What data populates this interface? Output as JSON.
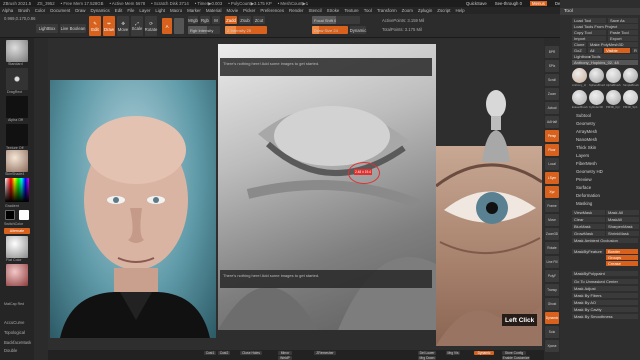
{
  "title_bar": {
    "app": "ZBrush 2021.5",
    "file": "ZS_3952",
    "mem1": "• Free Mem 17.528GB",
    "mem2": "• Active Mem 5678",
    "mem3": "• Scratch Disk 3714",
    "mem4": "• Timer▶0.003",
    "poly": "• PolyCount▶3.175 KP",
    "mesh": "• MeshCount▶1",
    "quicksave": "QuickSave",
    "seethrough": "See-through 0",
    "menus": "Menus",
    "script": "DefaultZScript"
  },
  "menu_bar": [
    "Alpha",
    "Brush",
    "Color",
    "Document",
    "Draw",
    "Dynamics",
    "Edit",
    "File",
    "Layer",
    "Light",
    "Macro",
    "Marker",
    "Material",
    "Movie",
    "Picker",
    "Preferences",
    "Render",
    "Stencil",
    "Stroke",
    "Texture",
    "Tool",
    "Transform",
    "Zoom",
    "Zplugin",
    "Zscript",
    "Help"
  ],
  "coords": "0.969,0.170,0.86",
  "toolbar": {
    "lightbox": "LightBox",
    "live_boolean": "Live Boolean",
    "edit": "Edit",
    "draw": "Draw",
    "move": "Move",
    "scale": "Scale",
    "rotate": "Rotate",
    "a": "A",
    "mrgb": "Mrgb",
    "rgb": "Rgb",
    "m": "M",
    "rgb_intensity": "Rgb Intensity",
    "zadd": "Zadd",
    "zsub": "Zsub",
    "zcut": "Zcut",
    "z_intensity": "Z Intensity 25",
    "focal_shift": "Focal Shift 0",
    "draw_size": "Draw Size 24",
    "dynamic": "Dynamic",
    "active_points": "ActivePoints: 3.159 Mil",
    "total_points": "TotalPoints: 3.175 Mil"
  },
  "left_tray": {
    "brush_label": "Standard",
    "stroke_label": "DragRect",
    "alpha_label": "Alpha Off",
    "texture_label": "Texture Off",
    "material_label": "SkinShade4",
    "gradient": "Gradient",
    "switch_color": "SwitchColor",
    "alternate": "Alternate",
    "flat_color": "Flat Color",
    "mat_label": "MatCap Red",
    "accucurve": "AccuCurve",
    "topological": "Topological",
    "backface_mask": "BackfaceMask",
    "double": "Double"
  },
  "viewport": {
    "spotlight_msg_top": "There's nothing here! Add some images to get started.",
    "spotlight_msg_bottom": "There's nothing here! Add some images to get started.",
    "left_click": "Left Click",
    "brush_readout": "2.48 ± 19.4"
  },
  "bottom_bar": {
    "cust1": "Cust1",
    "cust2": "Cust2",
    "close_holes": "Close Holes",
    "mirror": "Mirror",
    "weld": "WeldP",
    "zremesher": "ZRemesher",
    "del_lower": "Del Lower",
    "mrg_down": "Mrg Down",
    "mrg_vis": "Mrg Vis",
    "dyn": "Dynamic",
    "store_config": "Store Config",
    "enable_customize": "Enable Customize"
  },
  "right_panel": {
    "tool": "Tool",
    "load_tool": "Load Tool",
    "save_as": "Save As",
    "load_tools_from_project": "Load Tools From Project",
    "copy_tool": "Copy Tool",
    "paste_tool": "Paste Tool",
    "import": "Import",
    "export": "Export",
    "clone": "Clone",
    "make_polymesh": "Make PolyMesh3D",
    "goz": "GoZ",
    "all": "All",
    "visible": "Visible",
    "r": "R",
    "lightbox_tools": "Lightbox▸Tools",
    "current_tool": "Anthony_Hopkins_02. 48",
    "thumb_labels": [
      "Anthony_H",
      "SphereBrush",
      "AlphaBrush",
      "SimpleBrush",
      "EraserBrush",
      "Cylinder3D",
      "PM3D_Cyl",
      "PM3D_Sph"
    ],
    "subtool_list": [
      "Subtool",
      "Geometry",
      "ArrayMesh",
      "NanoMesh",
      "Thick Skin",
      "Layers",
      "FiberMesh",
      "Geometry HD",
      "Preview",
      "Surface",
      "Deformation",
      "Masking"
    ],
    "masking_rows": [
      [
        "ViewMask",
        "Mask All"
      ],
      [
        "Clear",
        "MaskAll"
      ],
      [
        "BlurMask",
        "SharpenMask"
      ],
      [
        "GrowMask",
        "ShrinkMask"
      ],
      [
        "Mask Ambient Occlusion",
        ""
      ]
    ],
    "mask_extra": [
      "MaskByFeature",
      "Border",
      "Groups",
      "Crease"
    ],
    "mask_by_polypaint": "MaskByPolypaint",
    "mask_rows2": [
      "Go To Unmasked Center",
      "Mask Adjust",
      "Mask By Fibers",
      "Mask By AO",
      "Mask By Cavity",
      "Mask By Smoothness"
    ]
  },
  "right_shelf": [
    "BPR",
    "SPix",
    "Scroll",
    "Zoom",
    "Actual",
    "AAHalf",
    "Persp",
    "Floor",
    "Local",
    "LSym",
    "Xyz",
    "Frame",
    "Move",
    "Zoom3D",
    "Rotate",
    "Line Fill",
    "PolyF",
    "Transp",
    "Ghost",
    "Dynamic",
    "Solo",
    "Xpose"
  ]
}
